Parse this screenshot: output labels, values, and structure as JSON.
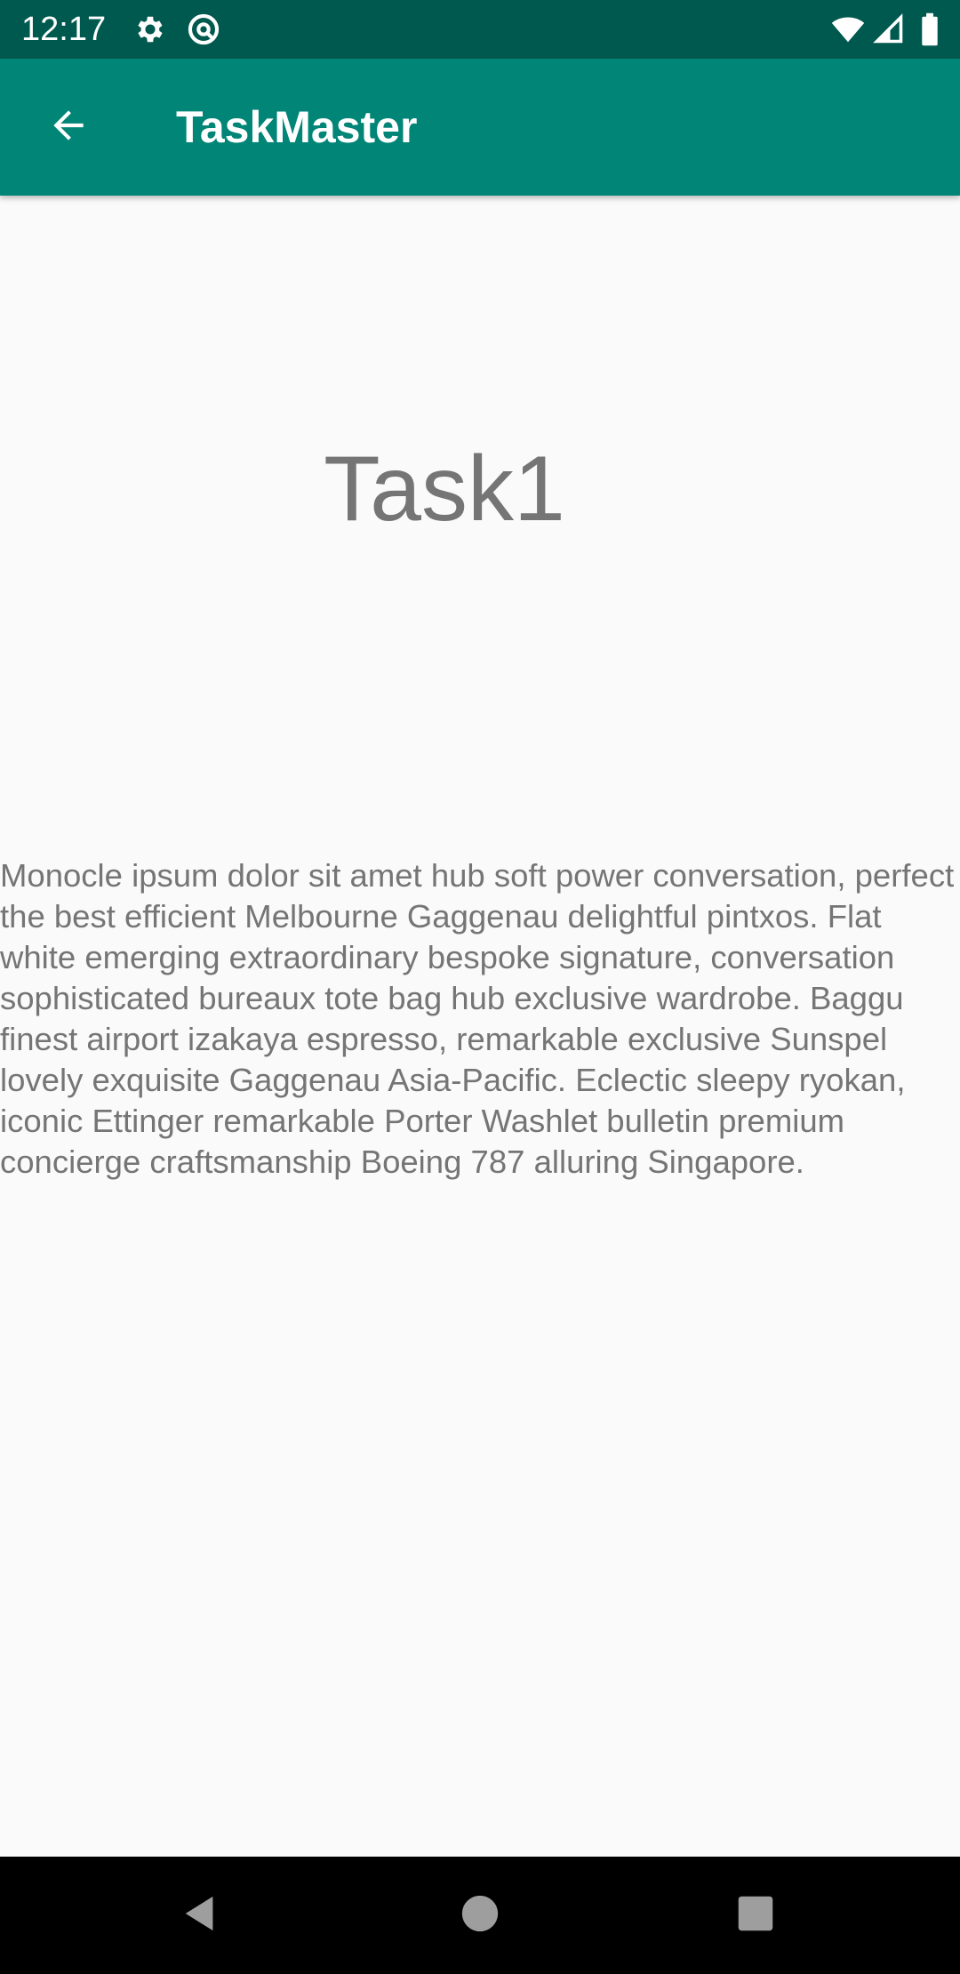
{
  "status_bar": {
    "time": "12:17",
    "left_icons": [
      "gear-icon",
      "at-sign-icon"
    ],
    "right_icons": [
      "wifi-icon",
      "cell-signal-icon",
      "battery-icon"
    ],
    "background_color": "#00594f"
  },
  "app_bar": {
    "title": "TaskMaster",
    "back_icon": "arrow-left-icon",
    "background_color": "#008577"
  },
  "task": {
    "title": "Task1",
    "body": "Monocle ipsum dolor sit amet hub soft power conversation, perfect the best efficient Melbourne Gaggenau delightful pintxos. Flat white emerging extraordinary bespoke signature, conversation sophisticated bureaux tote bag hub exclusive wardrobe. Baggu finest airport izakaya espresso, remarkable exclusive Sunspel lovely exquisite Gaggenau Asia-Pacific. Eclectic sleepy ryokan, iconic Ettinger remarkable Porter Washlet bulletin premium concierge craftsmanship Boeing 787 alluring Singapore."
  },
  "nav_bar": {
    "buttons": [
      "back-triangle-icon",
      "home-circle-icon",
      "recents-square-icon"
    ]
  }
}
